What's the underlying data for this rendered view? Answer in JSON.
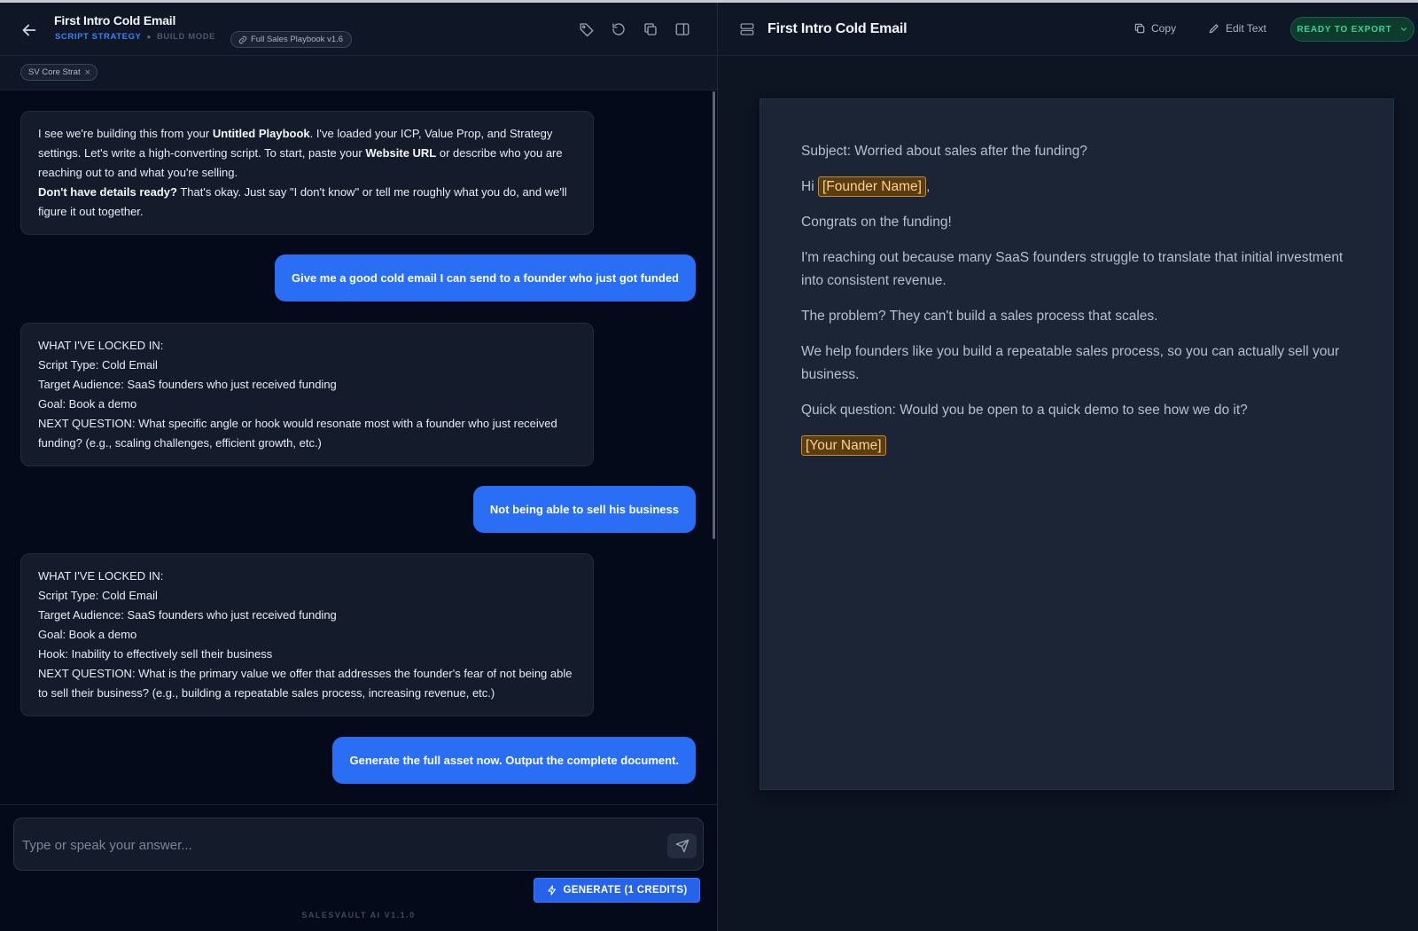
{
  "header": {
    "title": "First Intro Cold Email",
    "strategy": "SCRIPT STRATEGY",
    "mode": "BUILD MODE",
    "playbook": "Full Sales Playbook v1.6",
    "icons": [
      "tag-icon",
      "undo-icon",
      "copy-icon",
      "split-view-icon"
    ]
  },
  "filter_chip": "SV Core Strat",
  "chat": {
    "bot1": {
      "p1_a": "I see we're building this from your ",
      "p1_b": "Untitled Playbook",
      "p1_c": ". I've loaded your ICP, Value Prop, and Strategy settings. Let's write a high-converting script. To start, paste your ",
      "p1_d": "Website URL",
      "p1_e": " or describe who you are reaching out to and what you're selling.",
      "p2_a": "Don't have details ready?",
      "p2_b": " That's okay. Just say \"I don't know\" or tell me roughly what you do, and we'll figure it out together."
    },
    "user1": "Give me a good cold email I can send to a founder who just got funded",
    "bot2": {
      "l1": "WHAT I'VE LOCKED IN:",
      "l2": "Script Type: Cold Email",
      "l3": "Target Audience: SaaS founders who just received funding",
      "l4": "Goal: Book a demo",
      "l5": "NEXT QUESTION: What specific angle or hook would resonate most with a founder who just received funding? (e.g., scaling challenges, efficient growth, etc.)"
    },
    "user2": "Not being able to sell his business",
    "bot3": {
      "l1": "WHAT I'VE LOCKED IN:",
      "l2": "Script Type: Cold Email",
      "l3": "Target Audience: SaaS founders who just received funding",
      "l4": "Goal: Book a demo",
      "l5": "Hook: Inability to effectively sell their business",
      "l6": "NEXT QUESTION: What is the primary value we offer that addresses the founder's fear of not being able to sell their business? (e.g., building a repeatable sales process, increasing revenue, etc.)"
    },
    "user3": "Generate the full asset now. Output the complete document."
  },
  "composer": {
    "placeholder": "Type or speak your answer...",
    "generate_label": "GENERATE (1 CREDITS)",
    "version": "SALESVAULT AI V1.1.0"
  },
  "document": {
    "title": "First Intro Cold Email",
    "copy_label": "Copy",
    "edit_label": "Edit Text",
    "export_label": "READY TO EXPORT",
    "subject": "Subject: Worried about sales after the funding?",
    "greeting": "Hi",
    "founder_placeholder": "[Founder Name]",
    "greeting_end": ",",
    "congrats": "Congrats on the funding!",
    "para1": "I'm reaching out because many SaaS founders struggle to translate that initial investment into consistent revenue.",
    "para2": "The problem? They can't build a sales process that scales.",
    "para3": "We help founders like you build a repeatable sales process, so you can actually sell your business.",
    "para4": "Quick question: Would you be open to a quick demo to see how we do it?",
    "signature_placeholder": "[Your Name]"
  },
  "colors": {
    "user_bubble": "#2a6ef5",
    "accent_blue": "#3b82f6",
    "export_green": "#34d399",
    "placeholder_amber": "#c9882a"
  }
}
